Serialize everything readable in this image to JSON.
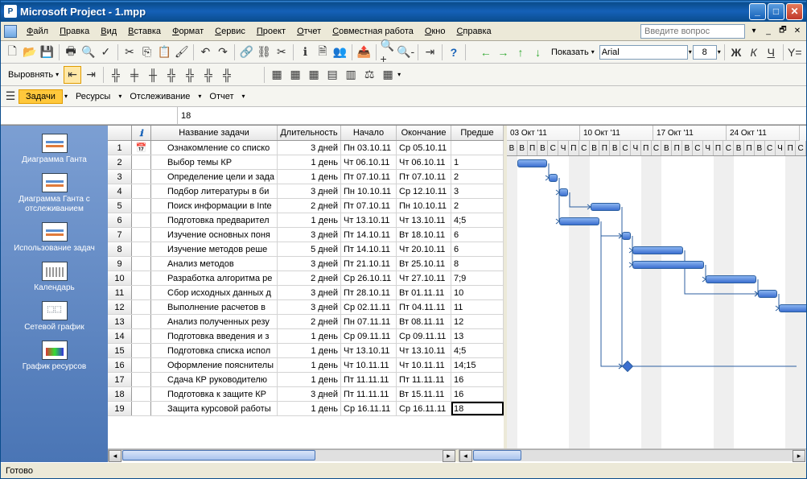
{
  "title": "Microsoft Project - 1.mpp",
  "menu": [
    "Файл",
    "Правка",
    "Вид",
    "Вставка",
    "Формат",
    "Сервис",
    "Проект",
    "Отчет",
    "Совместная работа",
    "Окно",
    "Справка"
  ],
  "ask_placeholder": "Введите вопрос",
  "toolbar_show": "Показать",
  "font_name": "Arial",
  "font_size": "8",
  "align_label": "Выровнять",
  "viewbar": {
    "tasks": "Задачи",
    "resources": "Ресурсы",
    "tracking": "Отслеживание",
    "report": "Отчет"
  },
  "formula_value": "18",
  "sidebar": [
    {
      "label": "Диаграмма Ганта",
      "icon": "gantt"
    },
    {
      "label": "Диаграмма Ганта с отслеживанием",
      "icon": "gantt"
    },
    {
      "label": "Использование задач",
      "icon": "gantt"
    },
    {
      "label": "Календарь",
      "icon": "cal"
    },
    {
      "label": "Сетевой график",
      "icon": "net"
    },
    {
      "label": "График ресурсов",
      "icon": "res"
    }
  ],
  "columns": {
    "info": "ℹ",
    "name": "Название задачи",
    "dur": "Длительность",
    "start": "Начало",
    "end": "Окончание",
    "pred": "Предше"
  },
  "weeks": [
    "03 Окт '11",
    "10 Окт '11",
    "17 Окт '11",
    "24 Окт '11"
  ],
  "daylabels": [
    "В",
    "П",
    "В",
    "С",
    "Ч",
    "П",
    "С"
  ],
  "tasks": [
    {
      "n": 1,
      "name": "Ознакомление со списко",
      "dur": "3 дней",
      "start": "Пн 03.10.11",
      "end": "Ср 05.10.11",
      "pred": "",
      "cal": 1,
      "bs": 2,
      "bl": 3
    },
    {
      "n": 2,
      "name": "Выбор темы КР",
      "dur": "1 день",
      "start": "Чт 06.10.11",
      "end": "Чт 06.10.11",
      "pred": "1",
      "bs": 5,
      "bl": 1
    },
    {
      "n": 3,
      "name": "Определение цели и зада",
      "dur": "1 день",
      "start": "Пт 07.10.11",
      "end": "Пт 07.10.11",
      "pred": "2",
      "bs": 6,
      "bl": 1
    },
    {
      "n": 4,
      "name": "Подбор литературы в би",
      "dur": "3 дней",
      "start": "Пн 10.10.11",
      "end": "Ср 12.10.11",
      "pred": "3",
      "bs": 9,
      "bl": 3
    },
    {
      "n": 5,
      "name": "Поиск информации в Inte",
      "dur": "2 дней",
      "start": "Пт 07.10.11",
      "end": "Пн 10.10.11",
      "pred": "2",
      "bs": 6,
      "bl": 4
    },
    {
      "n": 6,
      "name": "Подготовка предварител",
      "dur": "1 день",
      "start": "Чт 13.10.11",
      "end": "Чт 13.10.11",
      "pred": "4;5",
      "bs": 12,
      "bl": 1
    },
    {
      "n": 7,
      "name": "Изучение основных поня",
      "dur": "3 дней",
      "start": "Пт 14.10.11",
      "end": "Вт 18.10.11",
      "pred": "6",
      "bs": 13,
      "bl": 5
    },
    {
      "n": 8,
      "name": "Изучение методов реше",
      "dur": "5 дней",
      "start": "Пт 14.10.11",
      "end": "Чт 20.10.11",
      "pred": "6",
      "bs": 13,
      "bl": 7
    },
    {
      "n": 9,
      "name": "Анализ методов",
      "dur": "3 дней",
      "start": "Пт 21.10.11",
      "end": "Вт 25.10.11",
      "pred": "8",
      "bs": 20,
      "bl": 5
    },
    {
      "n": 10,
      "name": "Разработка алгоритма ре",
      "dur": "2 дней",
      "start": "Ср 26.10.11",
      "end": "Чт 27.10.11",
      "pred": "7;9",
      "bs": 25,
      "bl": 2
    },
    {
      "n": 11,
      "name": "Сбор исходных данных д",
      "dur": "3 дней",
      "start": "Пт 28.10.11",
      "end": "Вт 01.11.11",
      "pred": "10",
      "bs": 27,
      "bl": 5
    },
    {
      "n": 12,
      "name": "Выполнение расчетов в",
      "dur": "3 дней",
      "start": "Ср 02.11.11",
      "end": "Пт 04.11.11",
      "pred": "11",
      "bs": 0,
      "bl": 0
    },
    {
      "n": 13,
      "name": "Анализ полученных резу",
      "dur": "2 дней",
      "start": "Пн 07.11.11",
      "end": "Вт 08.11.11",
      "pred": "12",
      "bs": 0,
      "bl": 0
    },
    {
      "n": 14,
      "name": "Подготовка введения и з",
      "dur": "1 день",
      "start": "Ср 09.11.11",
      "end": "Ср 09.11.11",
      "pred": "13",
      "bs": 0,
      "bl": 0
    },
    {
      "n": 15,
      "name": "Подготовка списка испол",
      "dur": "1 день",
      "start": "Чт 13.10.11",
      "end": "Чт 13.10.11",
      "pred": "4;5",
      "bs": 12,
      "bl": 1,
      "ms": 1
    },
    {
      "n": 16,
      "name": "Оформление пояснителы",
      "dur": "1 день",
      "start": "Чт 10.11.11",
      "end": "Чт 10.11.11",
      "pred": "14;15",
      "bs": 0,
      "bl": 0
    },
    {
      "n": 17,
      "name": "Сдача КР руководителю",
      "dur": "1 день",
      "start": "Пт 11.11.11",
      "end": "Пт 11.11.11",
      "pred": "16",
      "bs": 0,
      "bl": 0
    },
    {
      "n": 18,
      "name": "Подготовка к защите КР",
      "dur": "3 дней",
      "start": "Пт 11.11.11",
      "end": "Вт 15.11.11",
      "pred": "16",
      "bs": 0,
      "bl": 0
    },
    {
      "n": 19,
      "name": "Защита курсовой работы",
      "dur": "1 день",
      "start": "Ср 16.11.11",
      "end": "Ср 16.11.11",
      "pred": "18",
      "bs": 0,
      "bl": 0,
      "sel": 1
    }
  ],
  "status": "Готово"
}
